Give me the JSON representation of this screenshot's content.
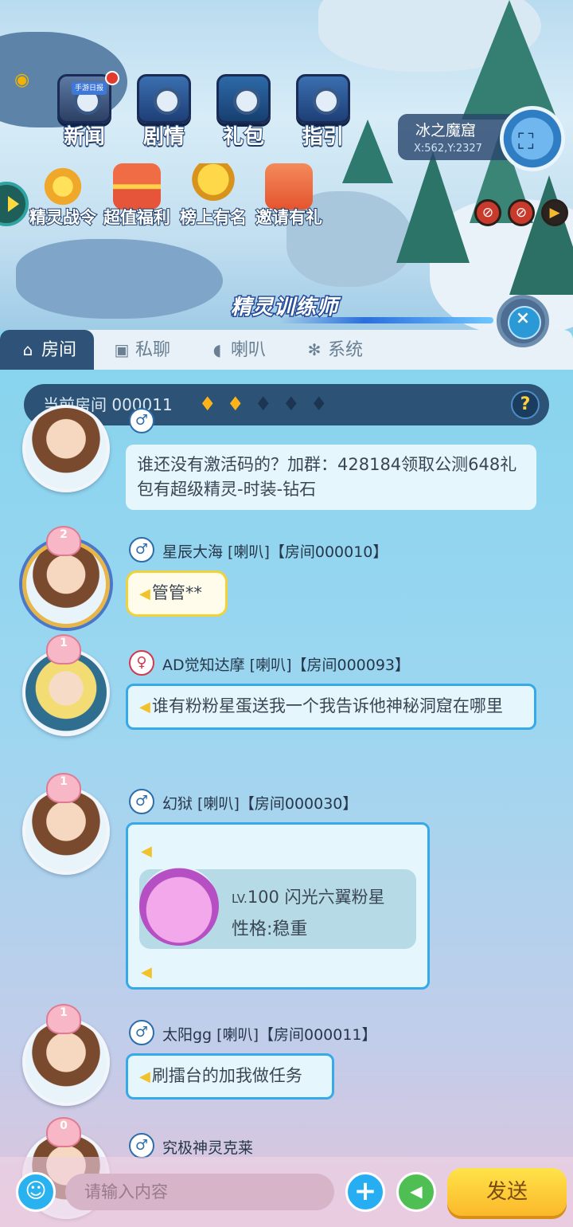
{
  "top_menu": [
    {
      "label": "新闻",
      "icon": "tv-icon"
    },
    {
      "label": "剧情",
      "icon": "safe-icon"
    },
    {
      "label": "礼包",
      "icon": "gift-box-icon"
    },
    {
      "label": "指引",
      "icon": "safe-icon"
    }
  ],
  "news_badge": "手游日报",
  "second_menu": [
    {
      "label": "精灵战令",
      "icon": "battle-pass-icon"
    },
    {
      "label": "超值福利",
      "icon": "gift-icon"
    },
    {
      "label": "榜上有名",
      "icon": "trophy-icon"
    },
    {
      "label": "邀请有礼",
      "icon": "invite-icon"
    }
  ],
  "map": {
    "title": "冰之魔窟",
    "coords": "X:562,Y:2327"
  },
  "trainer_title": "精灵训练师",
  "tabs": [
    {
      "label": "房间",
      "icon": "home-icon"
    },
    {
      "label": "私聊",
      "icon": "chat-screen-icon"
    },
    {
      "label": "喇叭",
      "icon": "megaphone-icon"
    },
    {
      "label": "系统",
      "icon": "gear-icon"
    }
  ],
  "room": {
    "label": "当前房间 000011",
    "flames_lit": 2,
    "flames_total": 5
  },
  "messages": [
    {
      "name": "",
      "text": "谁还没有激活码的？加群：428184领取公测648礼包有超级精灵-时装-钻石"
    },
    {
      "name": "星辰大海 [喇叭]【房间000010】",
      "text": "管管**",
      "crown_level": "2"
    },
    {
      "name": "AD觉知达摩 [喇叭]【房间000093】",
      "text": "谁有粉粉星蛋送我一个我告诉他神秘洞窟在哪里",
      "crown_level": "1"
    },
    {
      "name": "幻狱 [喇叭]【房间000030】",
      "crown_level": "1",
      "pet": {
        "level_prefix": "LV.",
        "level": "100",
        "name": "闪光六翼粉星",
        "trait": "性格:稳重"
      }
    },
    {
      "name": "太阳gg [喇叭]【房间000011】",
      "text": "刷擂台的加我做任务",
      "crown_level": "1"
    },
    {
      "name": "究极神灵克莱",
      "crown_level": "0"
    }
  ],
  "input": {
    "placeholder": "请输入内容",
    "send_label": "发送"
  },
  "colors": {
    "tab_active": "#2f5378",
    "send_button": "#fcc733",
    "horn_border": "#36a9e8"
  }
}
